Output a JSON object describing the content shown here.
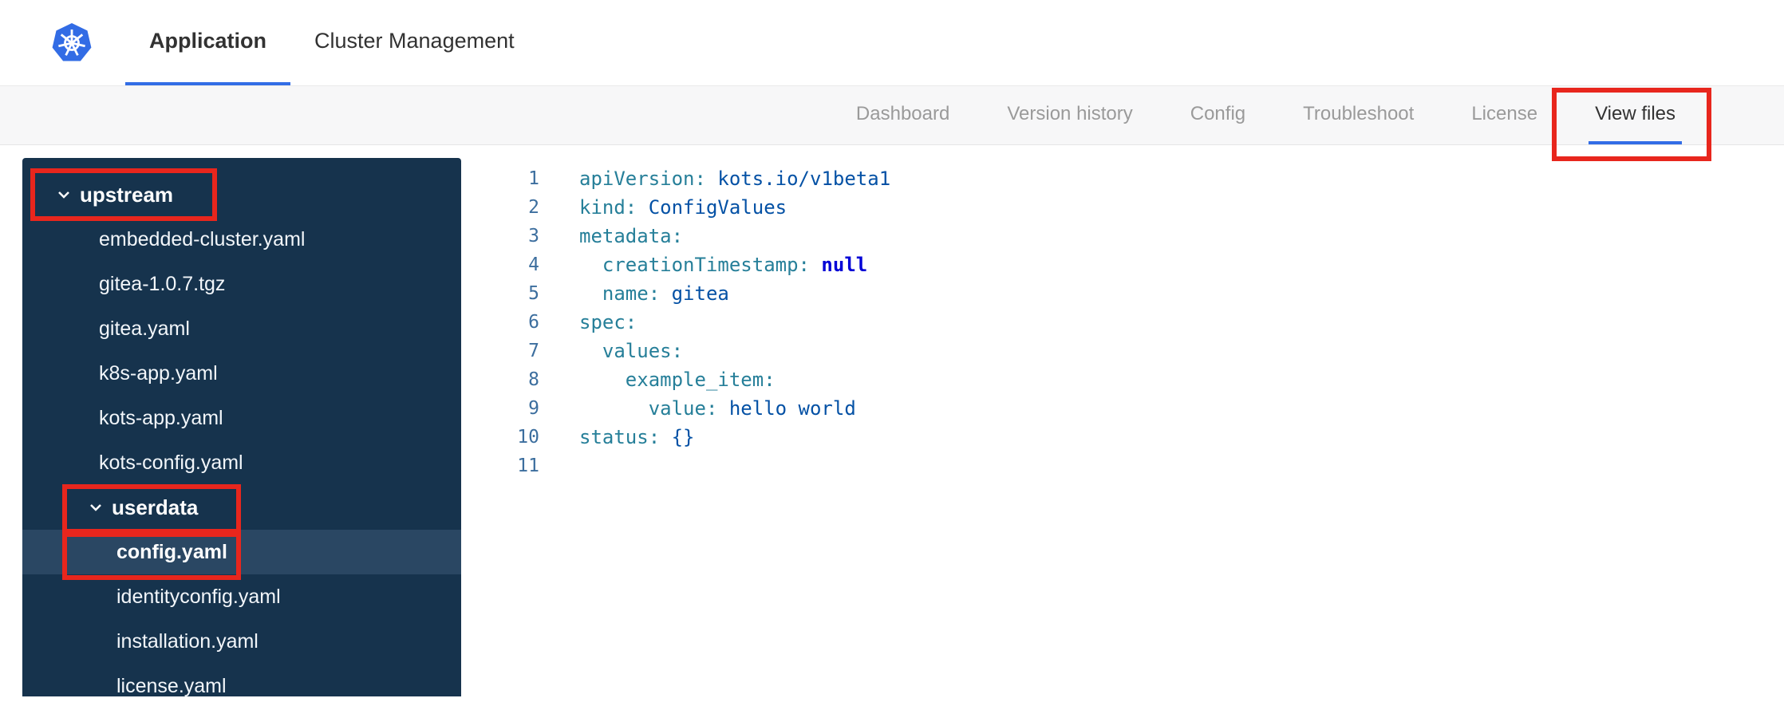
{
  "palette": {
    "accent_blue": "#326de6",
    "brand_blue": "#326ce5",
    "sidebar_bg": "#16334d",
    "sidebar_selected_bg": "#2a4763",
    "annotation_red": "#e8261d",
    "code_key_color": "#267f99",
    "code_value_color": "#0451a5",
    "code_keyword_color": "#0000d6",
    "line_number_color": "#3c6e9e"
  },
  "header": {
    "tabs": [
      {
        "label": "Application",
        "active": true
      },
      {
        "label": "Cluster Management",
        "active": false
      }
    ]
  },
  "subnav": {
    "tabs": [
      {
        "label": "Dashboard",
        "active": false
      },
      {
        "label": "Version history",
        "active": false
      },
      {
        "label": "Config",
        "active": false
      },
      {
        "label": "Troubleshoot",
        "active": false
      },
      {
        "label": "License",
        "active": false
      },
      {
        "label": "View files",
        "active": true
      }
    ]
  },
  "file_tree": {
    "items": [
      {
        "label": "upstream",
        "type": "group",
        "expanded": true
      },
      {
        "label": "embedded-cluster.yaml",
        "type": "file"
      },
      {
        "label": "gitea-1.0.7.tgz",
        "type": "file"
      },
      {
        "label": "gitea.yaml",
        "type": "file"
      },
      {
        "label": "k8s-app.yaml",
        "type": "file"
      },
      {
        "label": "kots-app.yaml",
        "type": "file"
      },
      {
        "label": "kots-config.yaml",
        "type": "file"
      },
      {
        "label": "userdata",
        "type": "group",
        "expanded": true
      },
      {
        "label": "config.yaml",
        "type": "file",
        "selected": true
      },
      {
        "label": "identityconfig.yaml",
        "type": "file"
      },
      {
        "label": "installation.yaml",
        "type": "file"
      },
      {
        "label": "license.yaml",
        "type": "file"
      }
    ]
  },
  "editor": {
    "lines": [
      {
        "n": "1",
        "key": "apiVersion:",
        "value": " kots.io/v1beta1"
      },
      {
        "n": "2",
        "key": "kind:",
        "value": " ConfigValues"
      },
      {
        "n": "3",
        "key": "metadata:"
      },
      {
        "n": "4",
        "key": "  creationTimestamp:",
        "keyword": " null"
      },
      {
        "n": "5",
        "key": "  name:",
        "value": " gitea"
      },
      {
        "n": "6",
        "key": "spec:"
      },
      {
        "n": "7",
        "key": "  values:"
      },
      {
        "n": "8",
        "key": "    example_item:"
      },
      {
        "n": "9",
        "key": "      value:",
        "value": " hello world"
      },
      {
        "n": "10",
        "key": "status:",
        "value": " {}"
      },
      {
        "n": "11"
      }
    ]
  },
  "annotations": {
    "color": "#e8261d",
    "targets": [
      "view-files-tab",
      "upstream-group",
      "userdata-group",
      "config-yaml-file"
    ]
  }
}
